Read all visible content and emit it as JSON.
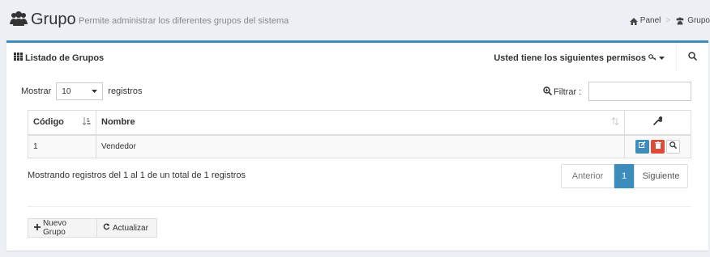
{
  "header": {
    "title": "Grupo",
    "subtitle": "Permite administrar los diferentes grupos del sistema",
    "breadcrumb": [
      {
        "label": "Panel",
        "icon": "home-icon"
      },
      {
        "label": "Grupo",
        "icon": "users-icon"
      }
    ]
  },
  "box": {
    "title": "Listado de Grupos",
    "permissions_label": "Usted tiene los siguientes permisos"
  },
  "table_controls": {
    "show_label": "Mostrar",
    "page_length": "10",
    "records_label": "registros",
    "filter_label": "Filtrar :",
    "filter_value": ""
  },
  "table": {
    "columns": [
      "Código",
      "Nombre"
    ],
    "rows": [
      {
        "codigo": "1",
        "nombre": "Vendedor"
      }
    ]
  },
  "pagination": {
    "info": "Mostrando registros del 1 al 1 de un total de 1 registros",
    "prev": "Anterior",
    "current": "1",
    "next": "Siguiente"
  },
  "footer": {
    "new_button": "Nuevo Grupo",
    "refresh_button": "Actualizar"
  },
  "colors": {
    "primary": "#3c8dbc",
    "danger": "#dd4b39",
    "background": "#ecf0f5"
  }
}
